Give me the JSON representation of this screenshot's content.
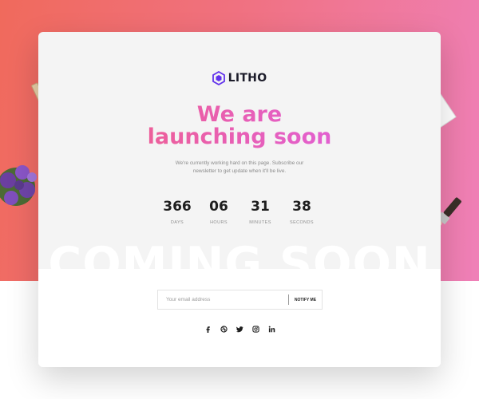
{
  "brand": {
    "name": "LITHO",
    "color": "#6132ec"
  },
  "hero": {
    "headline_line1": "We are",
    "headline_line2": "launching soon",
    "subtitle_line1": "We're currently working hard on this page. Subscribe our",
    "subtitle_line2": "newsletter to get update when it'll be live."
  },
  "countdown": [
    {
      "value": "366",
      "label": "DAYS"
    },
    {
      "value": "06",
      "label": "HOURS"
    },
    {
      "value": "31",
      "label": "MINUTES"
    },
    {
      "value": "38",
      "label": "SECONDS"
    }
  ],
  "banner_text": "COMING SOON",
  "newsletter": {
    "placeholder": "Your email address",
    "button_label": "NOTIFY ME"
  },
  "social_icons": [
    "facebook-icon",
    "dribbble-icon",
    "twitter-icon",
    "instagram-icon",
    "linkedin-icon"
  ],
  "colors": {
    "gradient_start": "#f06a5c",
    "gradient_end": "#ef80b8",
    "headline_start": "#f35f7a",
    "headline_end": "#dc5ff0"
  }
}
